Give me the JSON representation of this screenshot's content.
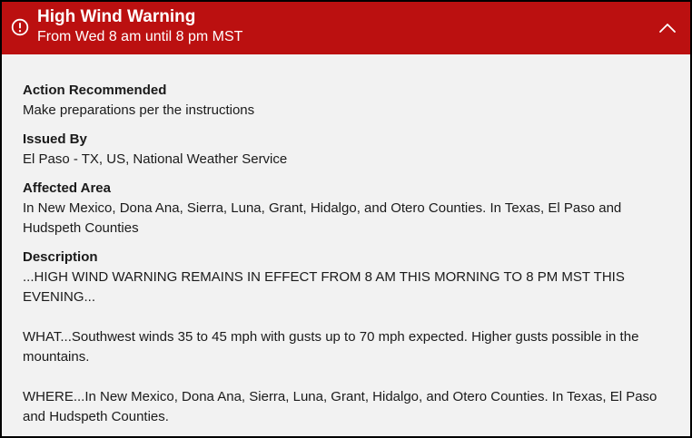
{
  "alert": {
    "title": "High Wind Warning",
    "subtitle": "From Wed 8 am until 8 pm MST",
    "header_color": "#bb1010",
    "icon": "alert-circle-icon",
    "toggle_icon": "chevron-up-icon"
  },
  "sections": {
    "action": {
      "label": "Action Recommended",
      "value": "Make preparations per the instructions"
    },
    "issued": {
      "label": "Issued By",
      "value": "El Paso - TX, US, National Weather Service"
    },
    "area": {
      "label": "Affected Area",
      "value": "In New Mexico, Dona Ana, Sierra, Luna, Grant, Hidalgo, and Otero Counties. In Texas, El Paso and Hudspeth Counties"
    },
    "description": {
      "label": "Description",
      "paragraphs": [
        "...HIGH WIND WARNING REMAINS IN EFFECT FROM 8 AM THIS MORNING TO 8 PM MST THIS EVENING...",
        "WHAT...Southwest winds 35 to 45 mph with gusts up to 70 mph expected. Higher gusts possible in the mountains.",
        "WHERE...In New Mexico, Dona Ana, Sierra, Luna, Grant, Hidalgo, and Otero Counties. In Texas, El Paso and Hudspeth Counties."
      ]
    }
  }
}
